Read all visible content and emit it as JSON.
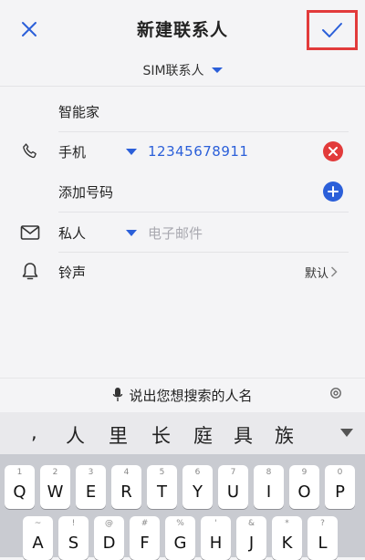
{
  "header": {
    "title": "新建联系人"
  },
  "account": {
    "label": "SIM联系人"
  },
  "fields": {
    "name_value": "智能家",
    "phone_label": "手机",
    "phone_value": "12345678911",
    "add_number_label": "添加号码",
    "email_label": "私人",
    "email_placeholder": "电子邮件",
    "ringtone_label": "铃声",
    "ringtone_value": "默认"
  },
  "voice_search": {
    "hint": "说出您想搜索的人名"
  },
  "candidates": {
    "items": [
      ",",
      "人",
      "里",
      "长",
      "庭",
      "具",
      "族"
    ]
  },
  "keyboard": {
    "row1": [
      {
        "key": "Q",
        "sub": "1"
      },
      {
        "key": "W",
        "sub": "2"
      },
      {
        "key": "E",
        "sub": "3"
      },
      {
        "key": "R",
        "sub": "4"
      },
      {
        "key": "T",
        "sub": "5"
      },
      {
        "key": "Y",
        "sub": "6"
      },
      {
        "key": "U",
        "sub": "7"
      },
      {
        "key": "I",
        "sub": "8"
      },
      {
        "key": "O",
        "sub": "9"
      },
      {
        "key": "P",
        "sub": "0"
      }
    ],
    "row2": [
      {
        "key": "A",
        "sub": "~"
      },
      {
        "key": "S",
        "sub": "!"
      },
      {
        "key": "D",
        "sub": "@"
      },
      {
        "key": "F",
        "sub": "#"
      },
      {
        "key": "G",
        "sub": "%"
      },
      {
        "key": "H",
        "sub": "'"
      },
      {
        "key": "J",
        "sub": "&"
      },
      {
        "key": "K",
        "sub": "*"
      },
      {
        "key": "L",
        "sub": "?"
      }
    ]
  },
  "colors": {
    "accent": "#2b5fd9",
    "danger": "#e23b3b"
  },
  "icons": {
    "close": "close-icon",
    "confirm": "check-icon",
    "phone": "phone-icon",
    "email": "mail-icon",
    "ringtone": "bell-icon",
    "mic": "microphone-icon",
    "settings": "gear-icon"
  }
}
